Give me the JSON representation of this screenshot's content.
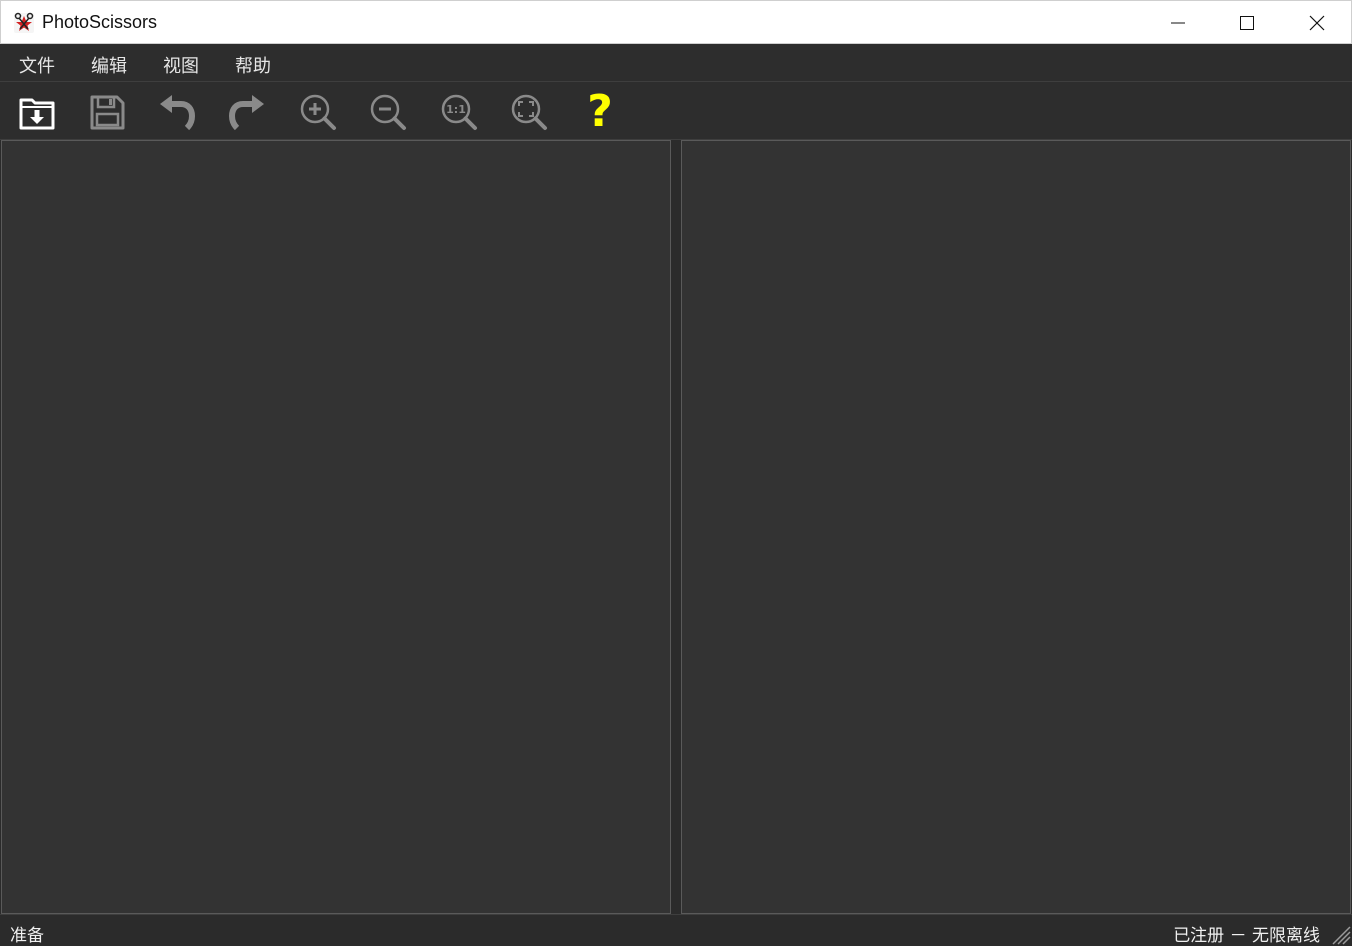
{
  "window": {
    "title": "PhotoScissors",
    "icons": {
      "app": "scissors-app-icon",
      "minimize": "minimize-icon",
      "maximize": "maximize-icon",
      "close": "close-icon"
    }
  },
  "menu": {
    "items": [
      {
        "label": "文件"
      },
      {
        "label": "编辑"
      },
      {
        "label": "视图"
      },
      {
        "label": "帮助"
      }
    ]
  },
  "toolbar": {
    "tools": [
      {
        "icon": "open-folder-icon"
      },
      {
        "icon": "save-disk-icon"
      },
      {
        "icon": "undo-icon"
      },
      {
        "icon": "redo-icon"
      },
      {
        "icon": "zoom-in-icon"
      },
      {
        "icon": "zoom-out-icon"
      },
      {
        "icon": "zoom-actual-size-icon",
        "text": "1:1"
      },
      {
        "icon": "zoom-fit-icon"
      },
      {
        "icon": "help-icon",
        "text": "?"
      }
    ]
  },
  "status": {
    "left": "准备",
    "right": "已注册 － 无限离线"
  },
  "colors": {
    "background": "#2b2b2b",
    "panel": "#333333",
    "help_accent": "#ffff00",
    "icon_gray": "#8a8a8a"
  }
}
